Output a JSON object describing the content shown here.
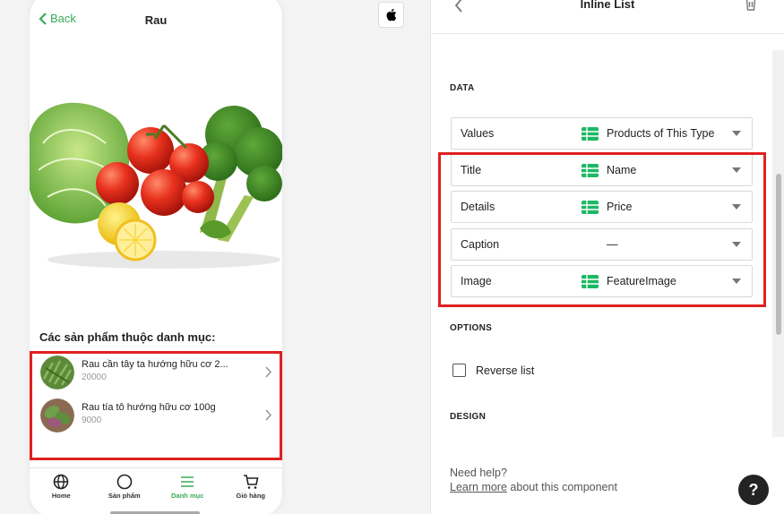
{
  "phone": {
    "back_label": "Back",
    "title": "Rau",
    "section_title": "Các sản phẩm thuộc danh mục:",
    "items": [
      {
        "title": "Rau cần tây ta hướng hữu cơ 2...",
        "price": "20000"
      },
      {
        "title": "Rau tía tô hướng hữu cơ 100g",
        "price": "9000"
      }
    ],
    "tabs": [
      {
        "label": "Home",
        "icon": "globe-icon"
      },
      {
        "label": "Sản phẩm",
        "icon": "circle-icon"
      },
      {
        "label": "Danh mục",
        "icon": "menu-icon"
      },
      {
        "label": "Giỏ hàng",
        "icon": "cart-icon"
      }
    ],
    "active_tab": "Danh mục"
  },
  "panel": {
    "title": "Inline List",
    "data_section": "DATA",
    "rows": [
      {
        "label": "Values",
        "value": "Products of This Type"
      },
      {
        "label": "Title",
        "value": "Name"
      },
      {
        "label": "Details",
        "value": "Price"
      },
      {
        "label": "Caption",
        "value": "—"
      },
      {
        "label": "Image",
        "value": "FeatureImage"
      }
    ],
    "options_section": "OPTIONS",
    "reverse_label": "Reverse list",
    "design_section": "DESIGN",
    "help_title": "Need help?",
    "help_link": "Learn more",
    "help_rest": " about this component",
    "help_button": "?"
  },
  "colors": {
    "accent_green": "#3aaa5a",
    "highlight_red": "#e02020",
    "sheet_green": "#1db864"
  }
}
